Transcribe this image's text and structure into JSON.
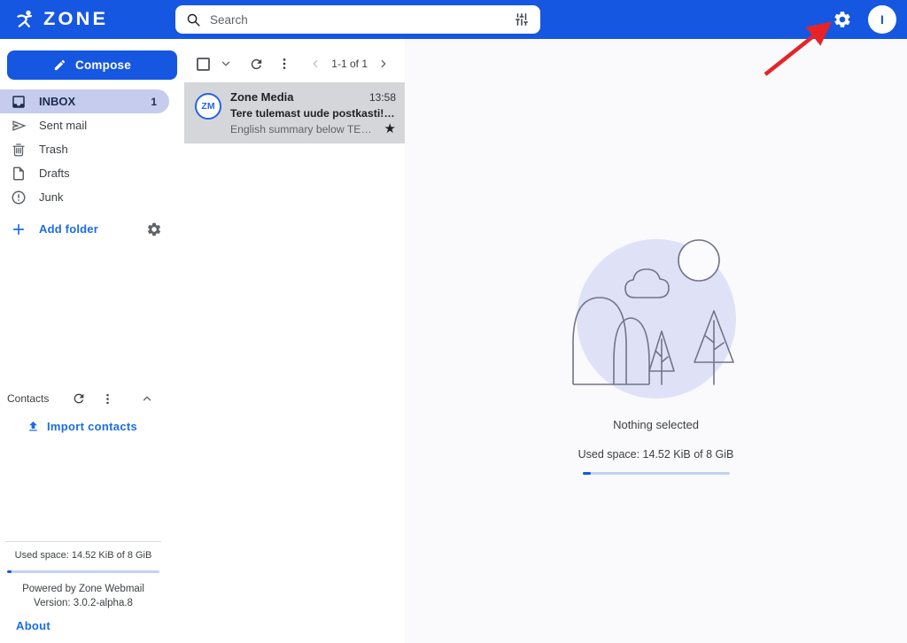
{
  "topbar": {
    "brand": "ZONE",
    "search_placeholder": "Search",
    "avatar_initial": "I"
  },
  "sidebar": {
    "compose_label": "Compose",
    "folders": [
      {
        "label": "INBOX",
        "badge": "1",
        "active": true
      },
      {
        "label": "Sent mail"
      },
      {
        "label": "Trash"
      },
      {
        "label": "Drafts"
      },
      {
        "label": "Junk"
      }
    ],
    "add_folder_label": "Add folder",
    "contacts_title": "Contacts",
    "import_contacts_label": "Import contacts",
    "used_space": "Used space: 14.52 KiB of 8 GiB",
    "powered_by": "Powered by Zone Webmail",
    "version": "Version: 3.0.2-alpha.8",
    "about_label": "About"
  },
  "maillist": {
    "pagination": "1-1 of 1",
    "email": {
      "initials": "ZM",
      "sender": "Zone Media",
      "time": "13:58",
      "subject": "Tere tulemast uude postkasti! / …",
      "preview": "English summary below TERE T…",
      "starred": true
    }
  },
  "main": {
    "empty_title": "Nothing selected",
    "used_space": "Used space: 14.52 KiB of 8 GiB"
  },
  "icons": {
    "star_glyph": "★",
    "names": [
      "zone-runner-icon",
      "search-icon",
      "tune-icon",
      "settings-icon",
      "compose-pencil-icon",
      "inbox-icon",
      "send-icon",
      "trash-icon",
      "drafts-icon",
      "junk-icon",
      "add-icon",
      "folder-settings-icon",
      "refresh-icon",
      "more-vertical-icon",
      "collapse-icon",
      "upload-icon",
      "select-all-checkbox",
      "select-dropdown-icon",
      "prev-page-icon",
      "next-page-icon",
      "star-icon",
      "annotation-arrow"
    ]
  },
  "colors": {
    "primary_blue": "#1657e2",
    "link_blue": "#1a6ce8",
    "inbox_selected_bg": "#c5cced",
    "email_row_bg": "#d5d6d9",
    "illustration_circle": "#dfe2f7",
    "progress_track": "#c3d2f2",
    "arrow_red": "#e62428"
  }
}
